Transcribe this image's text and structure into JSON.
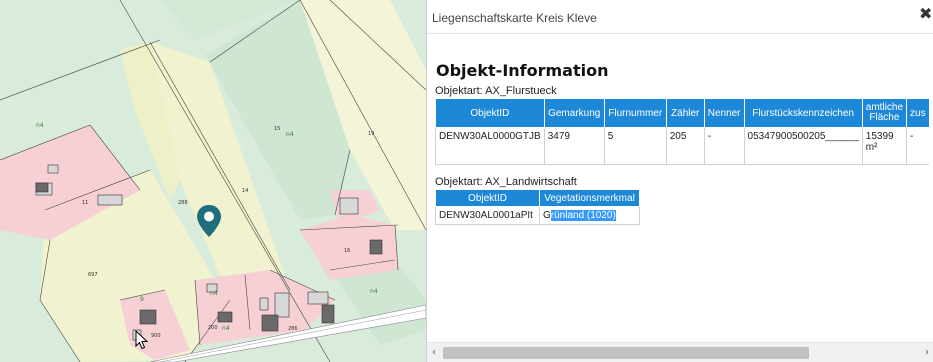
{
  "map": {
    "parcel_labels": [
      "n4",
      "15",
      "n4",
      "19",
      "11",
      "288",
      "14",
      "16",
      "n4",
      "697",
      "n4",
      "9",
      "900",
      "200",
      "n4",
      "286"
    ]
  },
  "panel": {
    "title": "Liegenschaftskarte Kreis Kleve",
    "close_icon": "close-icon",
    "heading": "Objekt-Information",
    "table1": {
      "objektart": "Objektart: AX_Flurstueck",
      "headers": [
        "ObjektID",
        "Gemarkung",
        "Flurnummer",
        "Zähler",
        "Nenner",
        "Flurstückskennzeichen",
        "amtliche Fläche",
        "zus"
      ],
      "row": [
        "DENW30AL0000GTJB",
        "3479",
        "5",
        "205",
        "-",
        "05347900500205______",
        "15399 m²",
        "-"
      ]
    },
    "table2": {
      "objektart": "Objektart: AX_Landwirtschaft",
      "headers": [
        "ObjektID",
        "Vegetationsmerkmal"
      ],
      "row_id": "DENW30AL0001aPIt",
      "row_value_prefix": "G",
      "row_value_selected": "rünland (1020)"
    }
  },
  "scrollbar": {
    "left_arrow": "‹",
    "right_arrow": "›"
  },
  "colors": {
    "header_blue": "#1e88d8",
    "selection_blue": "#3399ff",
    "marker_teal": "#1f6e7e",
    "parcel_yellow": "#f2f2cf",
    "parcel_green": "#cfe7d3",
    "parcel_pink": "#f6cfd3"
  }
}
